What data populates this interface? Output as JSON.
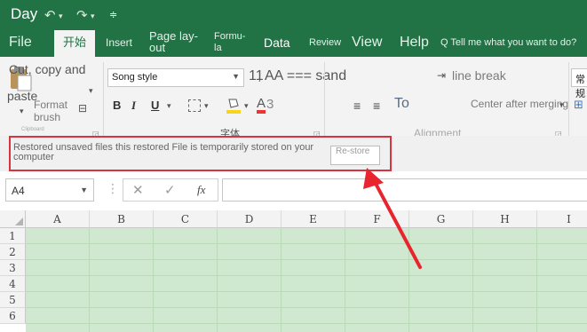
{
  "title": "Day",
  "tabs": {
    "file": "File",
    "home": "开始",
    "insert": "Insert",
    "page_layout": "Page lay-out",
    "formulas": "Formu-la",
    "data": "Data",
    "review": "Review",
    "view": "View",
    "help": "Help",
    "tell_me": "Q Tell me what you want to do?"
  },
  "clipboard": {
    "copy": "Cut, copy and",
    "paste": "paste",
    "format_brush": "Format brush",
    "group_label": "Clipboard"
  },
  "font": {
    "name": "Song style",
    "size": "11",
    "grow_shrink": ", AA === sand",
    "bold": "B",
    "italic": "I",
    "underline": "U",
    "font_color_label": "A",
    "font_color_suffix": "3",
    "group_label": "字体"
  },
  "alignment": {
    "line_break": "line break",
    "center_merge": "Center after merging",
    "to": "To",
    "group_label": "Alignment",
    "number_format": "常规"
  },
  "restore_bar": {
    "message": "Restored unsaved files this restored File is temporarily stored on your computer",
    "button": "Re-store"
  },
  "formula_bar": {
    "name_box": "A4",
    "fx": "fx"
  },
  "columns": [
    "A",
    "B",
    "C",
    "D",
    "E",
    "F",
    "G",
    "H",
    "I"
  ],
  "rows": [
    "1",
    "2",
    "3",
    "4",
    "5",
    "6"
  ],
  "colors": {
    "brand": "#217346",
    "highlight_border": "#d9333f",
    "annotation_arrow": "#e8242f",
    "sheet_fill": "#cfe8cf"
  }
}
